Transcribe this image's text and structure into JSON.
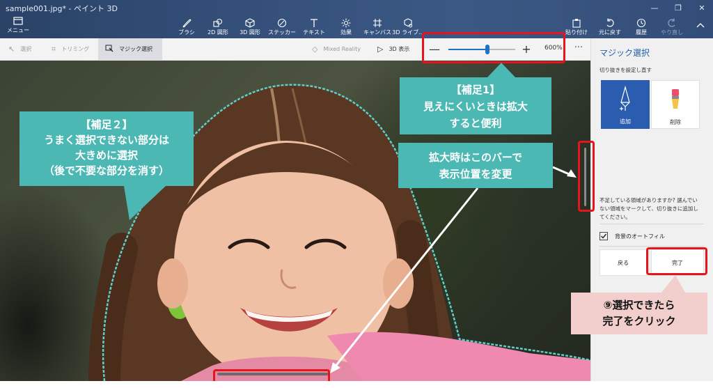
{
  "window": {
    "title": "sample001.jpg* - ペイント 3D",
    "menu_icon": "hamburger-menu-icon",
    "menu_label": "メニュー",
    "controls": [
      "—",
      "❐",
      "✕"
    ]
  },
  "ribbon": {
    "tools": [
      {
        "label": "ブラシ",
        "icon": "brush-icon"
      },
      {
        "label": "2D 図形",
        "icon": "shapes-2d-icon"
      },
      {
        "label": "3D 図形",
        "icon": "cube-icon"
      },
      {
        "label": "ステッカー",
        "icon": "sticker-icon"
      },
      {
        "label": "テキスト",
        "icon": "text-icon"
      },
      {
        "label": "効果",
        "icon": "effects-icon"
      },
      {
        "label": "キャンバス",
        "icon": "canvas-icon"
      },
      {
        "label": "3D ライブ...",
        "icon": "library-3d-icon"
      }
    ],
    "actions": [
      {
        "label": "貼り付け",
        "icon": "paste-icon"
      },
      {
        "label": "元に戻す",
        "icon": "undo-icon"
      },
      {
        "label": "履歴",
        "icon": "history-icon"
      },
      {
        "label": "やり直し",
        "icon": "redo-icon"
      }
    ]
  },
  "subtoolbar": {
    "select_label": "選択",
    "trim_label": "トリミング",
    "magic_label": "マジック選択",
    "mixed_reality_label": "Mixed Reality",
    "view3d_label": "3D 表示",
    "zoom_minus": "—",
    "zoom_plus": "+",
    "zoom_level": 0.58,
    "zoom_value": "600%",
    "more": "···"
  },
  "panel": {
    "title": "マジック選択",
    "reset_label": "切り抜きを設定し直す",
    "add_label": "追加",
    "remove_label": "削除",
    "help_text": "不足している領域がありますか? 選んでいない領域をマークして、切り抜きに追加してください。",
    "autofill_checked": true,
    "autofill_label": "背景のオートフィル",
    "back_label": "戻る",
    "done_label": "完了"
  },
  "annotations": {
    "note1": [
      "【補足1】",
      "見えにくいときは拡大",
      "すると便利"
    ],
    "note2": [
      "【補足２】",
      "うまく選択できない部分は",
      "大きめに選択",
      "（後で不要な部分を消す）"
    ],
    "note3": [
      "拡大時はこのバーで",
      "表示位置を変更"
    ],
    "note4": [
      "⑨選択できたら",
      "完了をクリック"
    ]
  },
  "colors": {
    "ribbon_bg": "#34507a",
    "accent_blue": "#2a5db0",
    "highlight_red": "#e8141d",
    "callout_teal": "#4cb8b4",
    "callout_pink": "#f2cfcd"
  }
}
